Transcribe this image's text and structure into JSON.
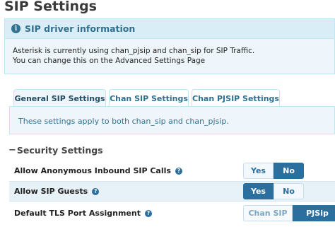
{
  "page": {
    "title": "SIP Settings"
  },
  "info_panel": {
    "icon": "info-icon",
    "title": "SIP driver information",
    "line1": "Asterisk is currently using chan_pjsip and chan_sip for SIP Traffic.",
    "line2": "You can change this on the Advanced Settings Page"
  },
  "tabs": [
    {
      "label": "General SIP Settings",
      "active": true
    },
    {
      "label": "Chan SIP Settings",
      "active": false
    },
    {
      "label": "Chan PJSIP Settings",
      "active": false
    }
  ],
  "tab_panel": {
    "text": "These settings apply to both chan_sip and chan_pjsip."
  },
  "section": {
    "collapse_symbol": "−",
    "title": "Security Settings"
  },
  "settings": [
    {
      "label": "Allow Anonymous Inbound SIP Calls",
      "options": [
        "Yes",
        "No"
      ],
      "selected": "No"
    },
    {
      "label": "Allow SIP Guests",
      "options": [
        "Yes",
        "No"
      ],
      "selected": "Yes"
    },
    {
      "label": "Default TLS Port Assignment",
      "options": [
        "Chan SIP",
        "PJSip"
      ],
      "selected": "PJSip"
    }
  ],
  "help_symbol": "?",
  "colors": {
    "accent": "#2b6f9e",
    "info_bg": "#d9edf7",
    "info_text": "#31708f"
  }
}
